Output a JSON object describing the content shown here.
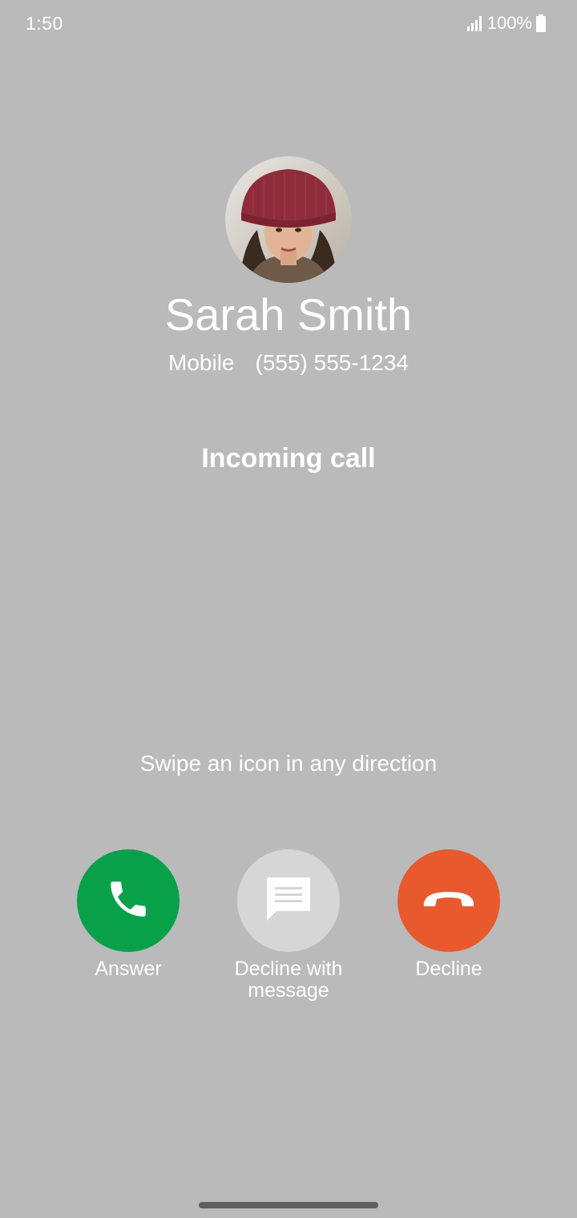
{
  "status_bar": {
    "time": "1:50",
    "battery_text": "100%",
    "icons": [
      "signal-icon",
      "battery-icon"
    ]
  },
  "caller": {
    "name": "Sarah Smith",
    "number_type": "Mobile",
    "number": "(555) 555-1234"
  },
  "call_status": "Incoming call",
  "swipe_hint": "Swipe an icon in any direction",
  "actions": [
    {
      "label": "Answer",
      "icon": "phone-icon",
      "color": "#09a04a"
    },
    {
      "label": "Decline with message",
      "icon": "message-icon",
      "color": "#d6d6d6"
    },
    {
      "label": "Decline",
      "icon": "hang-up-icon",
      "color": "#e8592d"
    }
  ],
  "colors": {
    "background": "#bababa",
    "text": "#ffffff"
  }
}
